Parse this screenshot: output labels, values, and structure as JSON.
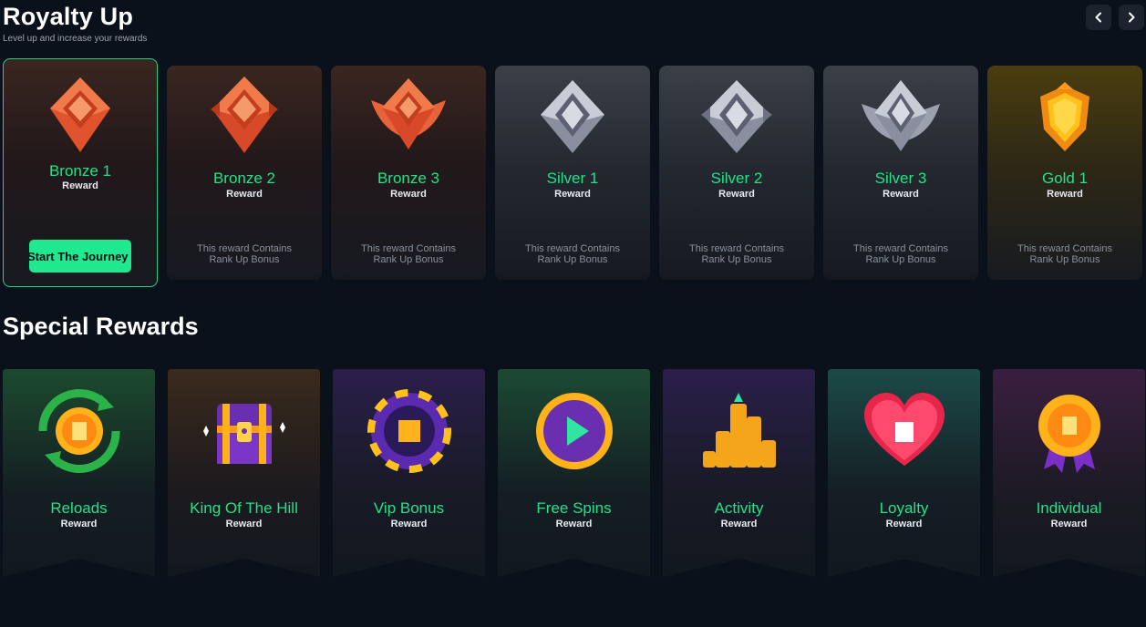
{
  "header": {
    "title": "Royalty Up",
    "subtitle": "Level up and increase your rewards"
  },
  "ranks": [
    {
      "name": "Bronze 1",
      "reward": "Reward",
      "cta": "Start The Journey",
      "tier": "bronze",
      "active": true
    },
    {
      "name": "Bronze 2",
      "reward": "Reward",
      "desc_line1": "This reward Contains",
      "desc_line2": "Rank Up Bonus",
      "tier": "bronze"
    },
    {
      "name": "Bronze 3",
      "reward": "Reward",
      "desc_line1": "This reward Contains",
      "desc_line2": "Rank Up Bonus",
      "tier": "bronze"
    },
    {
      "name": "Silver 1",
      "reward": "Reward",
      "desc_line1": "This reward Contains",
      "desc_line2": "Rank Up Bonus",
      "tier": "silver"
    },
    {
      "name": "Silver 2",
      "reward": "Reward",
      "desc_line1": "This reward Contains",
      "desc_line2": "Rank Up Bonus",
      "tier": "silver"
    },
    {
      "name": "Silver 3",
      "reward": "Reward",
      "desc_line1": "This reward Contains",
      "desc_line2": "Rank Up Bonus",
      "tier": "silver"
    },
    {
      "name": "Gold 1",
      "reward": "Reward",
      "desc_line1": "This reward Contains",
      "desc_line2": "Rank Up Bonus",
      "tier": "gold"
    }
  ],
  "special": {
    "title": "Special Rewards",
    "items": [
      {
        "name": "Reloads",
        "reward": "Reward",
        "icon": "reload-coin-icon",
        "color": "#1c4a2e"
      },
      {
        "name": "King Of The Hill",
        "reward": "Reward",
        "icon": "treasure-chest-icon",
        "color": "#3a2a1c"
      },
      {
        "name": "Vip Bonus",
        "reward": "Reward",
        "icon": "vip-chip-icon",
        "color": "#2a1f4a"
      },
      {
        "name": "Free Spins",
        "reward": "Reward",
        "icon": "play-button-icon",
        "color": "#1c4a34"
      },
      {
        "name": "Activity",
        "reward": "Reward",
        "icon": "coin-stacks-icon",
        "color": "#2a1f4a"
      },
      {
        "name": "Loyalty",
        "reward": "Reward",
        "icon": "heart-icon",
        "color": "#1c4a48"
      },
      {
        "name": "Individual",
        "reward": "Reward",
        "icon": "medal-icon",
        "color": "#3a1f40"
      }
    ]
  },
  "colors": {
    "accent": "#22e28c",
    "background": "#0b111a"
  }
}
